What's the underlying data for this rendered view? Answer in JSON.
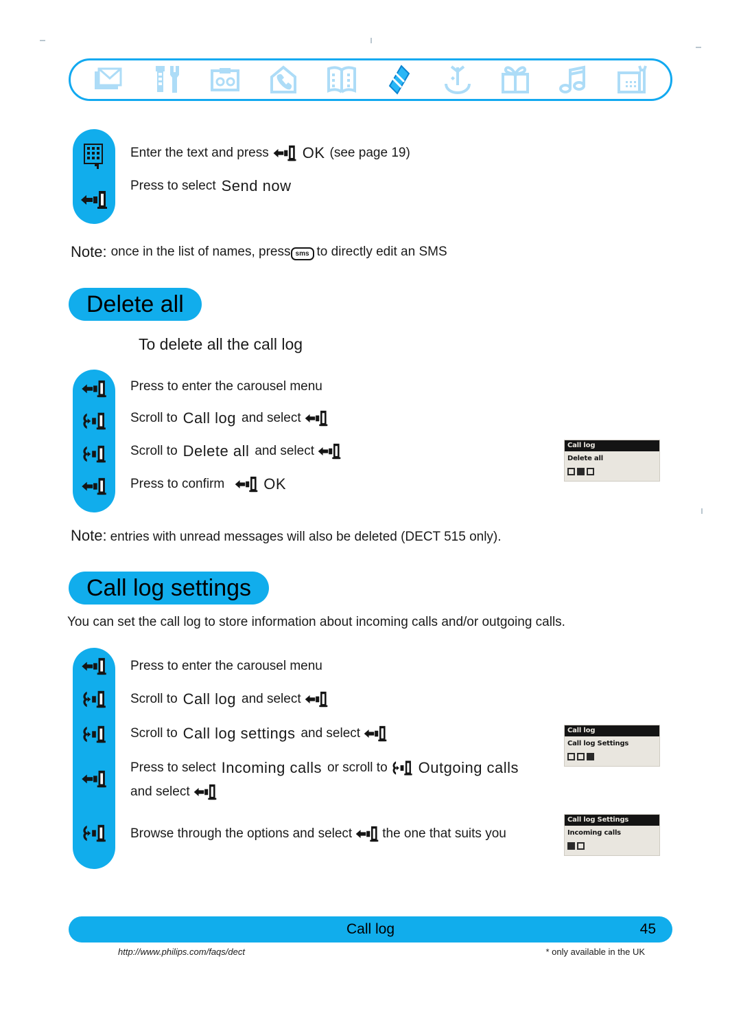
{
  "carousel": {
    "icons": [
      {
        "name": "envelope-icon",
        "label": "Messages"
      },
      {
        "name": "tools-icon",
        "label": "Settings"
      },
      {
        "name": "answering-machine-icon",
        "label": "Answering machine"
      },
      {
        "name": "home-phone-icon",
        "label": "Home"
      },
      {
        "name": "phonebook-icon",
        "label": "Phonebook"
      },
      {
        "name": "call-log-icon",
        "label": "Call log",
        "selected": true
      },
      {
        "name": "alarm-icon",
        "label": "Alarm"
      },
      {
        "name": "games-icon",
        "label": "Games"
      },
      {
        "name": "melody-icon",
        "label": "Melodies"
      },
      {
        "name": "base-station-icon",
        "label": "Base station"
      }
    ]
  },
  "sms_block": {
    "steps": [
      {
        "icon": "keypad-icon",
        "text_before": "Enter the text and press",
        "key": "ok-key-icon",
        "term": "OK",
        "text_after": "(see page 19)"
      },
      {
        "icon": "select-key-icon",
        "text_before": "Press to select",
        "term": "Send now",
        "text_after": ""
      }
    ]
  },
  "sms_note": {
    "prefix": "Note:",
    "text_before": "once in the list of names, press",
    "key_label": "sms",
    "text_after": "to directly edit an SMS"
  },
  "delete_all": {
    "heading": "Delete all",
    "subheading": "To delete all the call log",
    "steps": [
      {
        "icon": "select-key-icon",
        "text": "Press to enter the carousel menu"
      },
      {
        "icon": "scroll-key-icon",
        "text_before": "Scroll to",
        "term": "Call log",
        "text_after": "and select",
        "trailing_key": "select-key-icon"
      },
      {
        "icon": "scroll-key-icon",
        "text_before": "Scroll to",
        "term": "Delete all",
        "text_after": "and select",
        "trailing_key": "select-key-icon"
      },
      {
        "icon": "select-key-icon",
        "text_before": "Press to confirm",
        "trailing_key": "select-key-icon",
        "term": "OK"
      }
    ],
    "note": {
      "prefix": "Note:",
      "text": "entries with unread messages will also be deleted (DECT 515 only)."
    },
    "lcd": {
      "title": "Call log",
      "item": "Delete all",
      "icons": [
        "empty",
        "filled",
        "empty"
      ]
    }
  },
  "call_log_settings": {
    "heading": "Call log settings",
    "intro": "You can set the call log to store information about incoming calls and/or outgoing calls.",
    "steps": [
      {
        "icon": "select-key-icon",
        "text": "Press to enter the carousel menu"
      },
      {
        "icon": "scroll-key-icon",
        "text_before": "Scroll to",
        "term": "Call log",
        "text_after": "and select",
        "trailing_key": "select-key-icon"
      },
      {
        "icon": "scroll-key-icon",
        "text_before": "Scroll to",
        "term": "Call log settings",
        "text_after": "and select",
        "trailing_key": "select-key-icon"
      },
      {
        "icon": "select-key-icon",
        "text_before": "Press to select",
        "term": "Incoming calls",
        "text_mid": "or scroll to",
        "inline_key": "scroll-key-icon",
        "term2": "Outgoing calls",
        "line2_before": "and select",
        "line2_key": "select-key-icon"
      },
      {
        "icon": "scroll-key-icon",
        "text_before": "Browse through the options and select",
        "inline_key": "select-key-icon",
        "text_after": "the one that suits you"
      }
    ],
    "lcd_top": {
      "title": "Call log",
      "item": "Call log Settings",
      "icons": [
        "empty",
        "empty",
        "filled"
      ]
    },
    "lcd_bottom": {
      "title": "Call log Settings",
      "item": "Incoming calls",
      "icons": [
        "filled",
        "empty"
      ]
    }
  },
  "footer": {
    "title": "Call log",
    "page": "45",
    "url": "http://www.philips.com/faqs/dect",
    "uk_note": "* only available in the UK"
  }
}
